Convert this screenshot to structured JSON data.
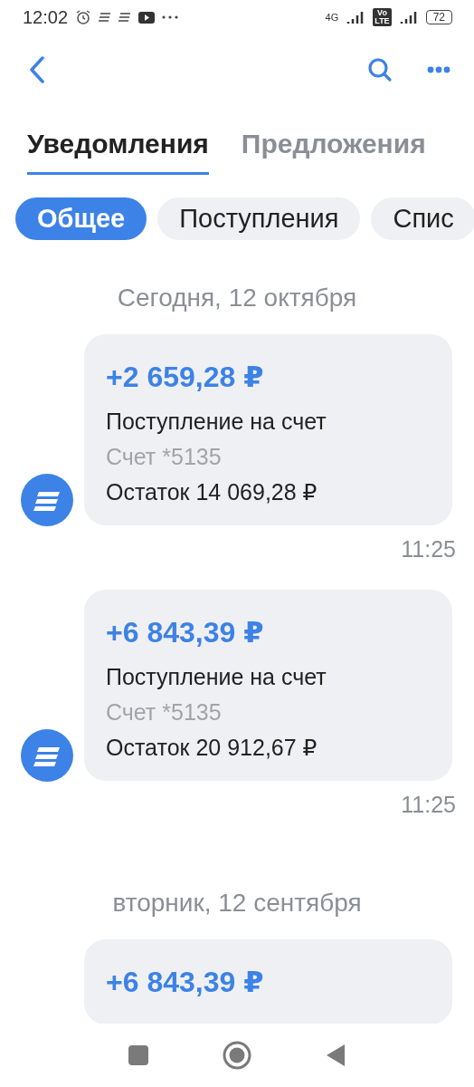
{
  "status_bar": {
    "time": "12:02",
    "network": "4G",
    "volte": [
      "Vo",
      "LTE"
    ],
    "battery": "72"
  },
  "tabs": [
    {
      "label": "Уведомления",
      "selected": true
    },
    {
      "label": "Предложения",
      "selected": false
    }
  ],
  "chips": [
    {
      "label": "Общее",
      "selected": true
    },
    {
      "label": "Поступления",
      "selected": false
    },
    {
      "label": "Спис",
      "selected": false
    }
  ],
  "groups": [
    {
      "date": "Сегодня, 12 октября",
      "messages": [
        {
          "amount": "+2 659,28 ₽",
          "title": "Поступление на счет",
          "account": "Счет *5135",
          "balance": "Остаток 14 069,28 ₽",
          "time": "11:25"
        },
        {
          "amount": "+6 843,39 ₽",
          "title": "Поступление на счет",
          "account": "Счет *5135",
          "balance": "Остаток 20 912,67 ₽",
          "time": "11:25"
        }
      ]
    },
    {
      "date": "вторник, 12 сентября",
      "messages": [
        {
          "amount": "+6 843,39 ₽"
        }
      ]
    }
  ]
}
